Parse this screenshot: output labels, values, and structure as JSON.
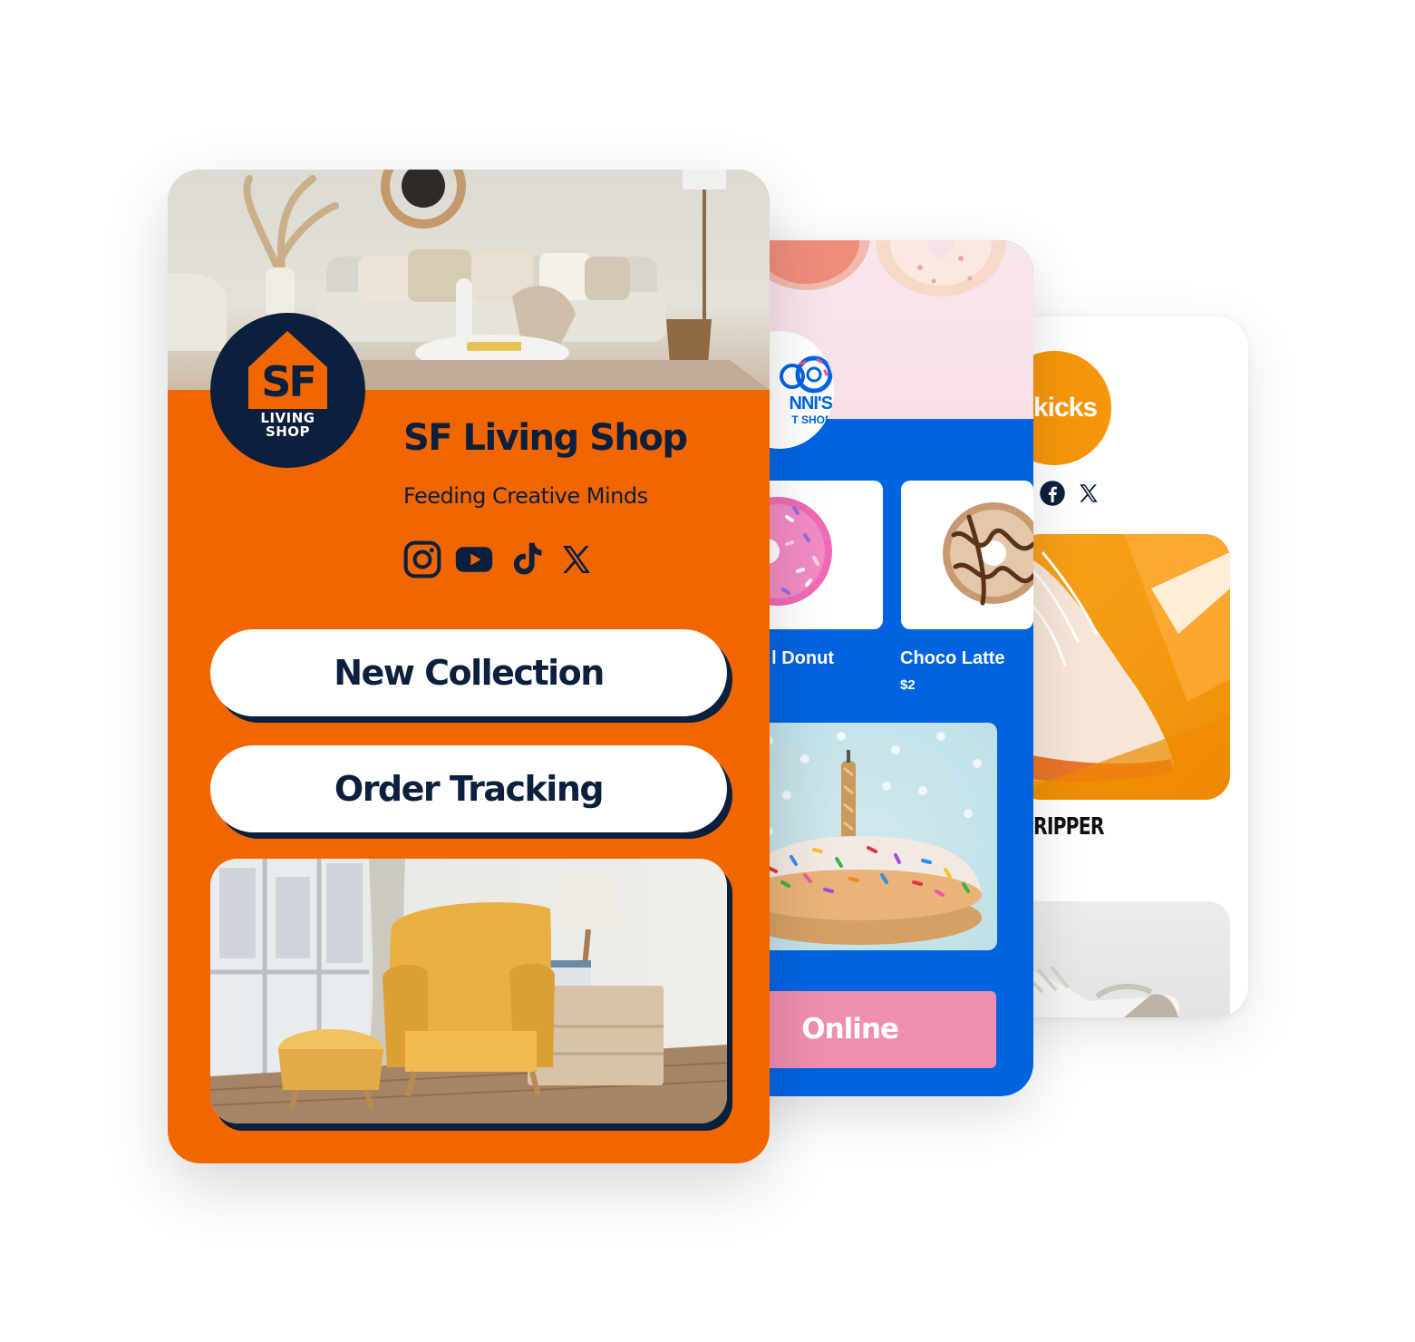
{
  "colors": {
    "sf_orange": "#f26600",
    "sf_navy": "#0c1f3d",
    "donut_blue": "#0064e0",
    "donut_pink": "#ef8eb0",
    "kicks_orange": "#f7950a"
  },
  "sf_card": {
    "logo": {
      "line1": "SF",
      "line2": "LIVING",
      "line3": "SHOP"
    },
    "title": "SF Living Shop",
    "tagline": "Feeding Creative Minds",
    "socials": [
      "instagram-icon",
      "youtube-icon",
      "tiktok-icon",
      "x-icon"
    ],
    "buttons": [
      {
        "label": "New Collection"
      },
      {
        "label": "Order Tracking"
      }
    ]
  },
  "donut_card": {
    "logo": {
      "line1": "NNI'S",
      "line2": "T SHOP"
    },
    "items": [
      {
        "name": "l Donut"
      },
      {
        "name": "Choco Latte",
        "price": "$2"
      }
    ],
    "order_button": "Online"
  },
  "kicks_card": {
    "logo_text": "kicks",
    "socials": [
      "facebook-icon",
      "x-icon"
    ],
    "product_name": "RIPPER"
  }
}
